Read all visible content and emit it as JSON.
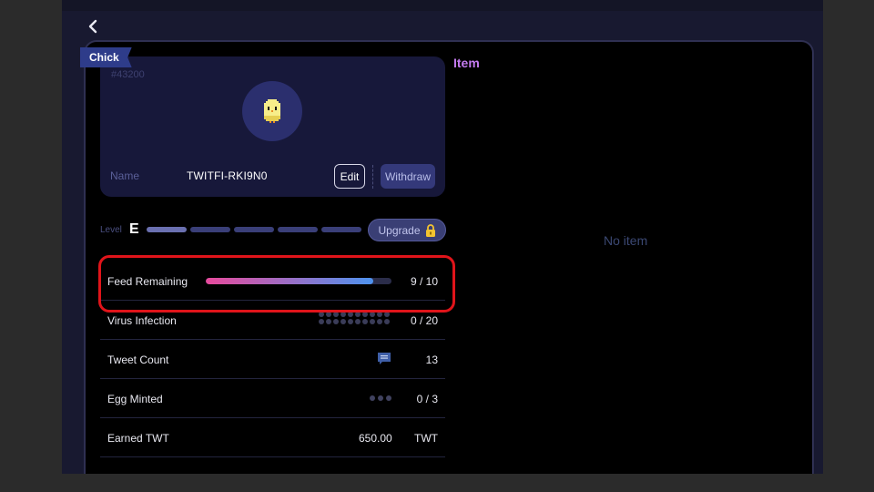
{
  "nft": {
    "tag": "Chick",
    "id": "#43200",
    "name_label": "Name",
    "name_value": "TWITFI-RKI9N0",
    "edit_label": "Edit",
    "withdraw_label": "Withdraw"
  },
  "level": {
    "label": "Level",
    "value": "E",
    "segments_total": 5,
    "segments_filled": 1,
    "upgrade_label": "Upgrade"
  },
  "stats": {
    "feed": {
      "label": "Feed Remaining",
      "value": "9 / 10",
      "fill_fraction": 0.9
    },
    "virus": {
      "label": "Virus Infection",
      "value": "0 / 20"
    },
    "tweet": {
      "label": "Tweet Count",
      "value": "13"
    },
    "egg": {
      "label": "Egg Minted",
      "value": "0 / 3"
    },
    "earned": {
      "label": "Earned TWT",
      "amount": "650.00",
      "unit": "TWT"
    }
  },
  "item_panel": {
    "title": "Item",
    "empty_text": "No item"
  },
  "colors": {
    "accent_purple": "#c47bf0",
    "highlight_red": "#e0141a",
    "feed_gradient_start": "#e84a9c",
    "feed_gradient_end": "#4d93ef",
    "card_bg": "#17183a"
  },
  "icons": {
    "back": "chevron-left-icon",
    "avatar": "chick-icon",
    "lock": "lock-icon",
    "tweet": "chat-bubble-icon"
  }
}
